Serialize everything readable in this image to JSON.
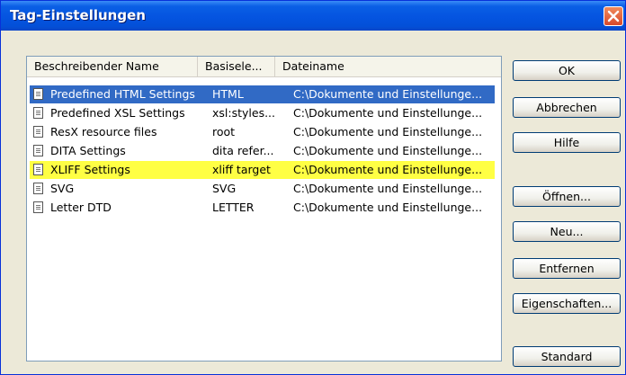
{
  "window": {
    "title": "Tag-Einstellungen"
  },
  "table": {
    "columns": [
      "Beschreibender Name",
      "Basisele...",
      "Dateiname"
    ],
    "rows": [
      {
        "name": "Predefined HTML Settings",
        "base": "HTML",
        "file": "C:\\Dokumente und Einstellunge..."
      },
      {
        "name": "Predefined XSL Settings",
        "base": "xsl:styles...",
        "file": "C:\\Dokumente und Einstellunge..."
      },
      {
        "name": "ResX resource files",
        "base": "root",
        "file": "C:\\Dokumente und Einstellunge..."
      },
      {
        "name": "DITA Settings",
        "base": "dita refer...",
        "file": "C:\\Dokumente und Einstellunge..."
      },
      {
        "name": "XLIFF Settings",
        "base": "xliff target",
        "file": "C:\\Dokumente und Einstellunge..."
      },
      {
        "name": "SVG",
        "base": "SVG",
        "file": "C:\\Dokumente und Einstellunge..."
      },
      {
        "name": "Letter DTD",
        "base": "LETTER",
        "file": "C:\\Dokumente und Einstellunge..."
      }
    ]
  },
  "buttons": {
    "ok": "OK",
    "cancel": "Abbrechen",
    "help": "Hilfe",
    "open": "Öffnen...",
    "new": "Neu...",
    "remove": "Entfernen",
    "properties": "Eigenschaften...",
    "default": "Standard"
  },
  "colors": {
    "selection": "#316AC5",
    "highlight": "#FFFF44",
    "titlebar": "#0554E0"
  }
}
